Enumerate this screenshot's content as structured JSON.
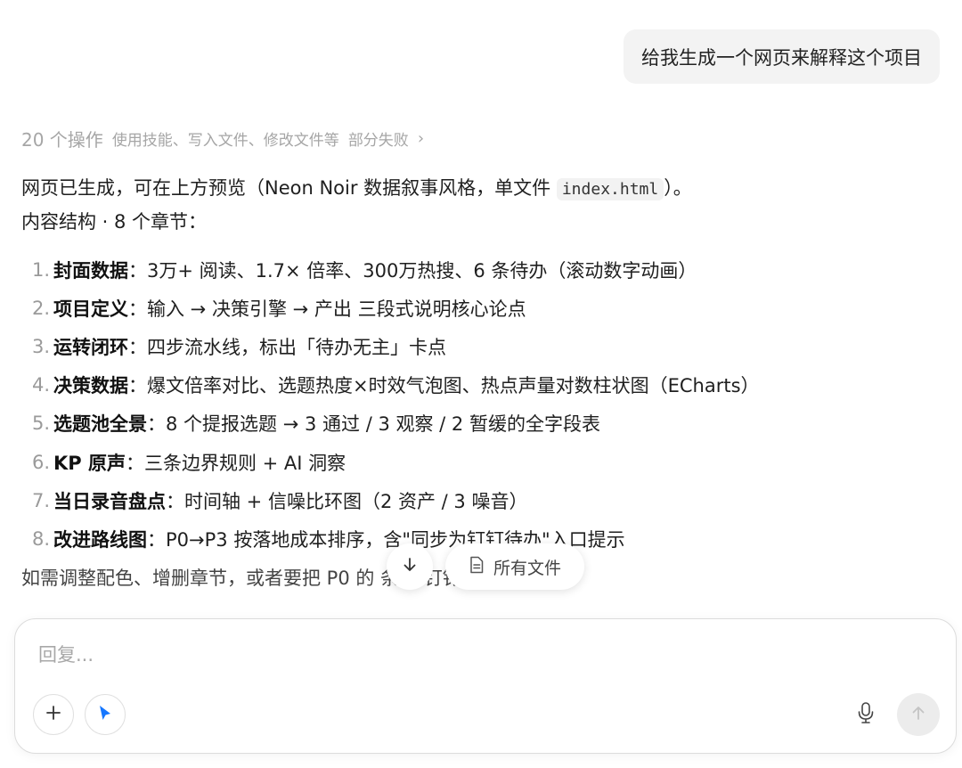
{
  "user_message": "给我生成一个网页来解释这个项目",
  "operations": {
    "count_label": "20 个操作",
    "detail": "使用技能、写入文件、修改文件等",
    "status": "部分失败"
  },
  "reply": {
    "intro_prefix": "网页已生成，可在上方预览（Neon Noir 数据叙事风格，单文件 ",
    "intro_code": "index.html",
    "intro_suffix": "）。",
    "structure_title": "内容结构 · 8 个章节：",
    "items": [
      {
        "num": "1.",
        "title": "封面数据",
        "desc": "：3万+ 阅读、1.7× 倍率、300万热搜、6 条待办（滚动数字动画）"
      },
      {
        "num": "2.",
        "title": "项目定义",
        "desc": "：输入 → 决策引擎 → 产出 三段式说明核心论点"
      },
      {
        "num": "3.",
        "title": "运转闭环",
        "desc": "：四步流水线，标出「待办无主」卡点"
      },
      {
        "num": "4.",
        "title": "决策数据",
        "desc": "：爆文倍率对比、选题热度×时效气泡图、热点声量对数柱状图（ECharts）"
      },
      {
        "num": "5.",
        "title": "选题池全景",
        "desc": "：8 个提报选题 → 3 通过 / 3 观察 / 2 暂缓的全字段表"
      },
      {
        "num": "6.",
        "title": "KP 原声",
        "desc": "：三条边界规则 + AI 洞察"
      },
      {
        "num": "7.",
        "title": "当日录音盘点",
        "desc": "：时间轴 + 信噪比环图（2 资产 / 3 噪音）"
      },
      {
        "num": "8.",
        "title": "改进路线图",
        "desc": "：P0→P3 按落地成本排序，含\"同步为钉钉待办\"入口提示"
      }
    ],
    "closing": "如需调整配色、增删章节，或者要把 P0 的 条 到钉钉，随时说。"
  },
  "floating": {
    "files_label": "所有文件"
  },
  "composer": {
    "placeholder": "回复..."
  },
  "icons": {
    "scroll_down": "arrow-down-icon",
    "files": "document-icon",
    "add": "plus-icon",
    "agent": "cursor-arrow-icon",
    "mic": "microphone-icon",
    "send": "arrow-up-icon"
  },
  "colors": {
    "accent_blue": "#1677ff",
    "muted_gray": "#a6a6a6"
  }
}
